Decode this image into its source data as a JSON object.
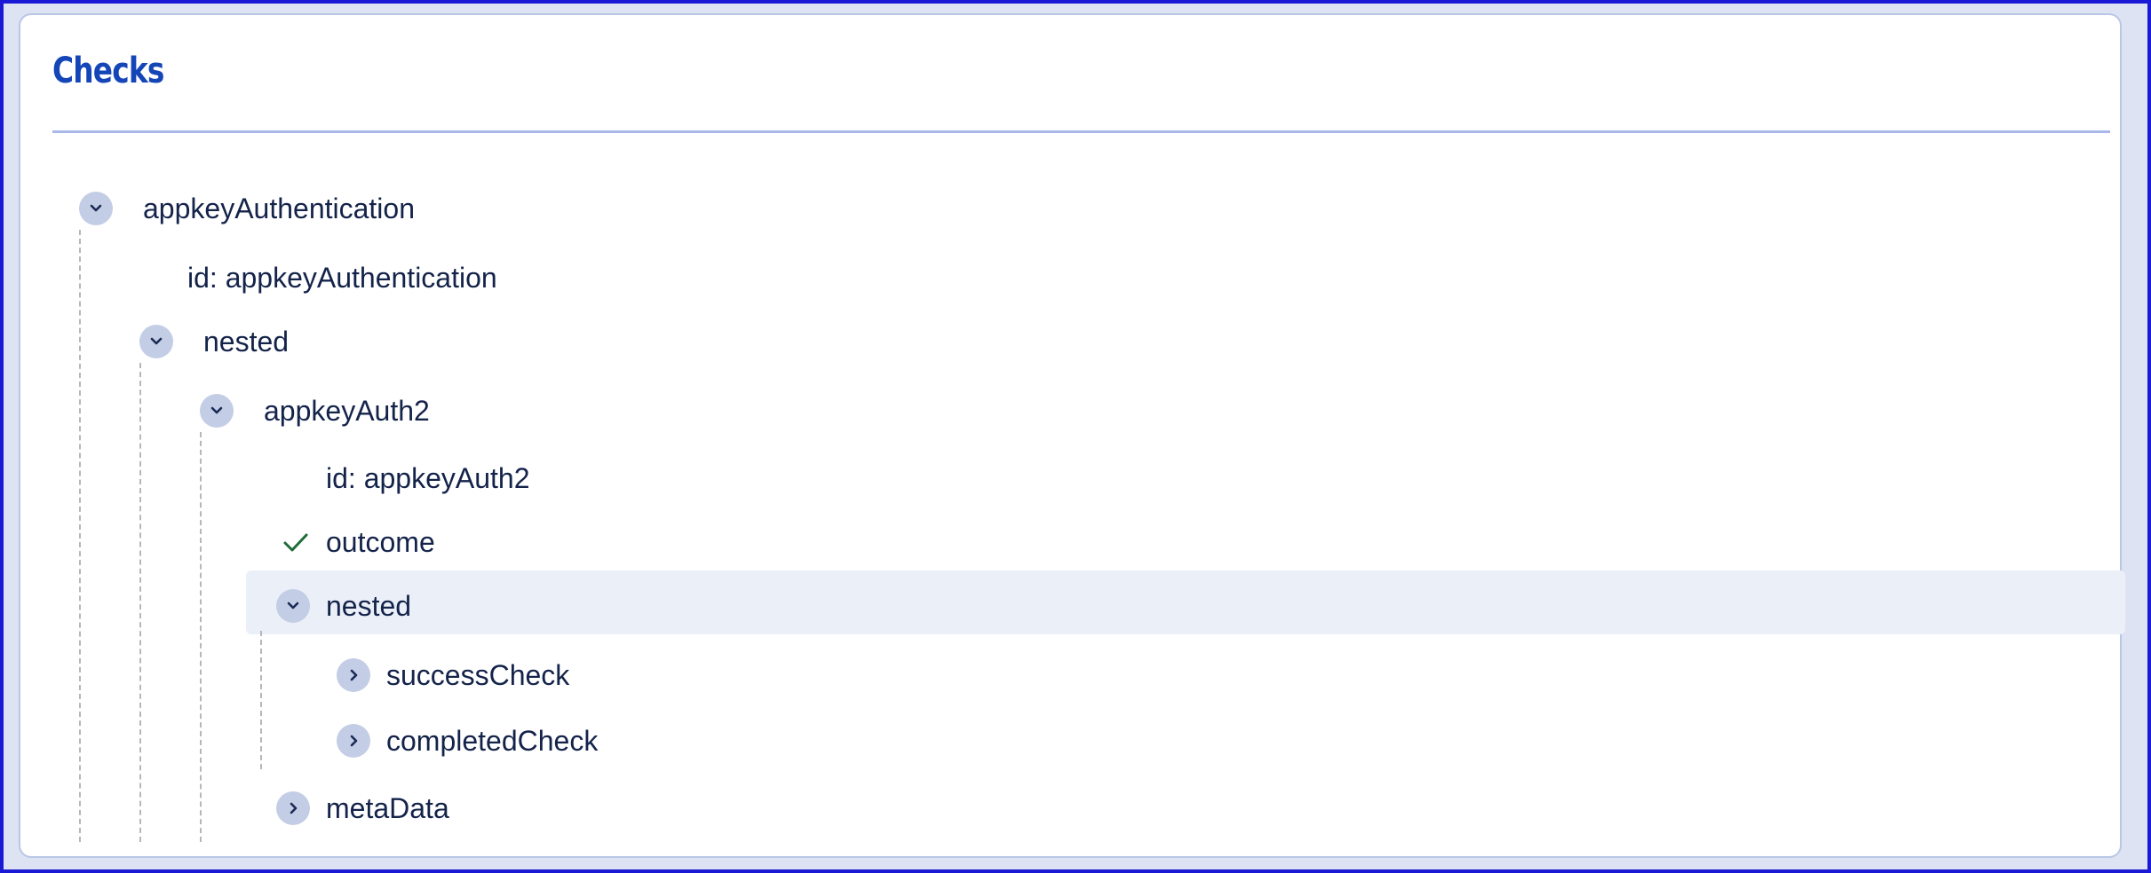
{
  "panel": {
    "title": "Checks"
  },
  "tree": {
    "root_label": "appkeyAuthentication",
    "root_id": "id: appkeyAuthentication",
    "nested1_label": "nested",
    "auth2_label": "appkeyAuth2",
    "auth2_id": "id: appkeyAuth2",
    "outcome_label": "outcome",
    "nested2_label": "nested",
    "success_label": "successCheck",
    "completed_label": "completedCheck",
    "metadata_label": "metaData"
  },
  "colors": {
    "title": "#1546b8",
    "toggle_bg": "#c3cde5",
    "selected_row_bg": "#ebf0f8",
    "check": "#1f6b3a"
  }
}
